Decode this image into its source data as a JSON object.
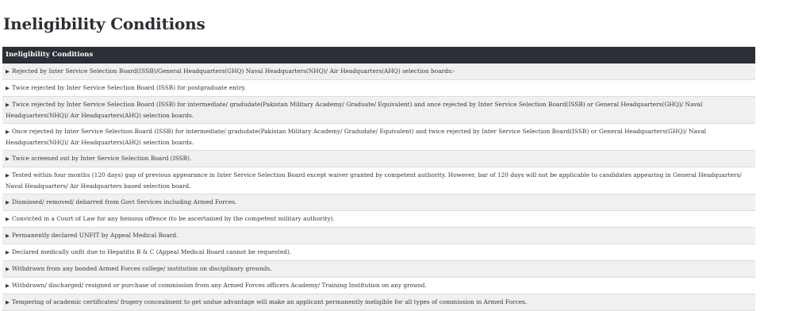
{
  "page_title": "Ineligibility Conditions",
  "table": {
    "header": "Ineligibility Conditions",
    "bullet": "▶",
    "rows": [
      "Rejected by Inter Service Selection Board(ISSB)/General Headquarters(GHQ) Naval Headquarters(NHQ)/ Air Headquarters(AHQ) selection boards:-",
      "Twice rejected by Inter Service Selection Board (ISSB) for postgraduate entry.",
      "Twice rejected by Inter Service Selection Board (ISSB) for intermediate/ gradudate(Pakistan Military Academy/ Graduate/ Equivalent) and once rejected by Inter Service Selection Board(ISSB) or General Headquarters(GHQ)/ Naval Headquarters(NHQ)/ Air Headquarters(AHQ) selection boards.",
      "Once rejected by Inter Service Selection Board (ISSB) for intermediate/ gradudate(Pakistan Military Academy/ Gradudate/ Equivalent) and twice rejected by Inter Service Selection Board(ISSB) or General Headquarters(GHQ)/ Naval Headquarters(NHQ)/ Air Headquarters(AHQ) selection boards.",
      "Twice screened out by Inter Service Selection Board (ISSB).",
      "Tested within four months (120 days) gap of previous appearance in Inter Service Selection Board except waiver granted by competent authority. However, bar of 120 days will not be applicable to candidates appearing in General Headquarters/ Naval Headquarters/ Air Headquarters based selection board.",
      "Dismissed/ removed/ debarred from Govt Services including Armed Forces.",
      "Convicted in a Court of Law for any heinous offence (to be ascertained by the competent military authority).",
      "Permanently declared UNFIT by Appeal Medical Board.",
      "Declared medically unfit due to Hepatitis B & C (Appeal Medical Board cannot be requested).",
      "Withdrawn from any bonded Armed Forces college/ institution on disciplinary grounds.",
      "Withdrawn/ discharged/ resigned or purchase of commission from any Armed Forces officers Academy/ Training Institution on any ground.",
      "Tempering of academic certificates/ frogery concealment to get undue advantage will make an applicant permanently ineligible for all types of commission in Armed Forces."
    ]
  }
}
